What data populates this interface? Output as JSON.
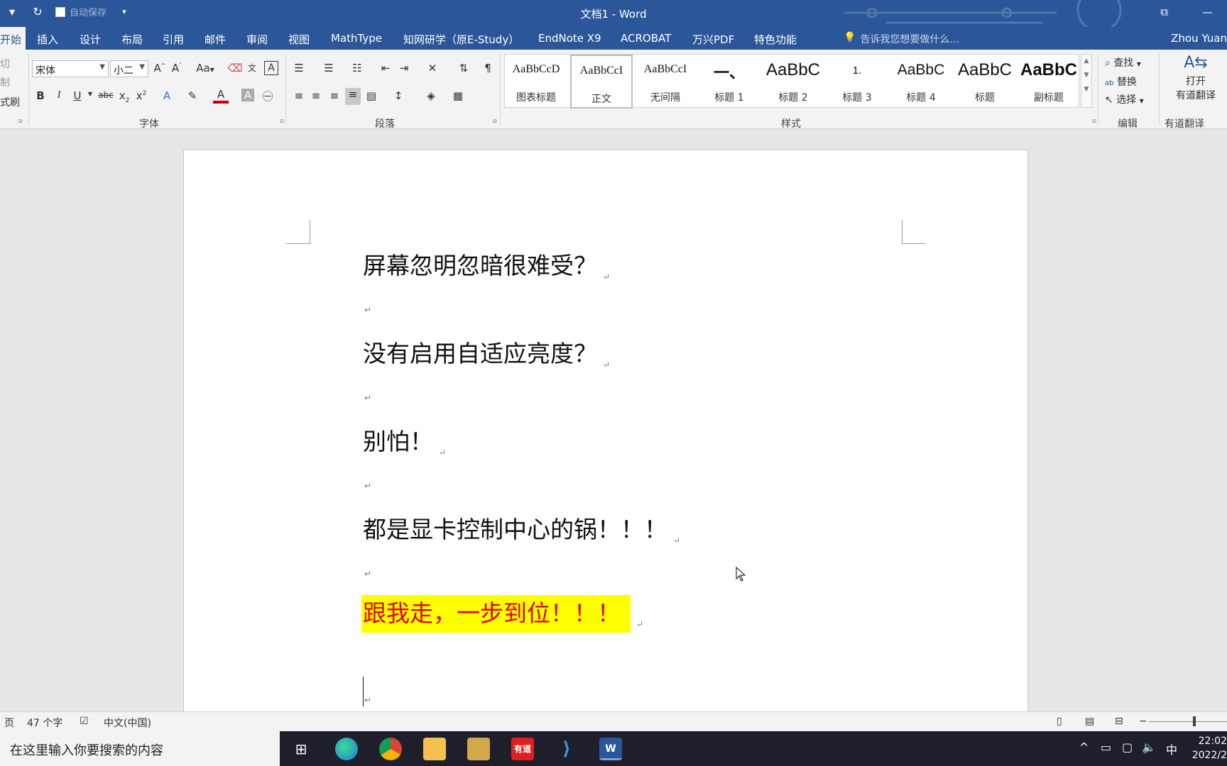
{
  "window": {
    "title": "文档1 - Word",
    "autosave_label": "自动保存",
    "user": "Zhou Yuan"
  },
  "tabs": [
    "开始",
    "插入",
    "设计",
    "布局",
    "引用",
    "邮件",
    "审阅",
    "视图",
    "MathType",
    "知网研学（原E-Study）",
    "EndNote X9",
    "ACROBAT",
    "万兴PDF",
    "特色功能"
  ],
  "tell_me": "告诉我您想要做什么...",
  "ribbon": {
    "clipboard": {
      "cut": "切",
      "copy": "制",
      "format_painter": "式刷"
    },
    "font": {
      "name": "宋体",
      "size": "小二",
      "change_case": "Aa",
      "group_label": "字体"
    },
    "paragraph": {
      "group_label": "段落"
    },
    "styles": {
      "group_label": "样式",
      "items": [
        {
          "sample": "AaBbCcD",
          "name": "图表标题"
        },
        {
          "sample": "AaBbCcI",
          "name": "正文"
        },
        {
          "sample": "AaBbCcI",
          "name": "无间隔"
        },
        {
          "sample": "一、",
          "name": "标题 1"
        },
        {
          "sample": "AaBbC",
          "name": "标题 2"
        },
        {
          "sample": "1.",
          "name": "标题 3"
        },
        {
          "sample": "AaBbC",
          "name": "标题 4"
        },
        {
          "sample": "AaBbC",
          "name": "标题"
        },
        {
          "sample": "AaBbC",
          "name": "副标题"
        }
      ]
    },
    "editing": {
      "find": "查找",
      "replace": "替换",
      "select": "选择",
      "group_label": "编辑"
    },
    "youdao": {
      "open": "打开",
      "translate": "有道翻译",
      "group_label": "有道翻译"
    }
  },
  "document": {
    "paragraphs": [
      "屏幕忽明忽暗很难受？",
      "没有启用自适应亮度？",
      "别怕！",
      "都是显卡控制中心的锅！！！",
      "跟我走，一步到位！！！"
    ],
    "paragraph_mark": "↵",
    "highlight_color": "#ffff00",
    "highlight_text_color": "#e00000"
  },
  "status": {
    "page": "页",
    "word_count": "47 个字",
    "language": "中文(中国)"
  },
  "taskbar": {
    "search_placeholder": "在这里输入你要搜索的内容",
    "youdao_label": "有道",
    "ime": "中",
    "time": "22:02",
    "date": "2022/2"
  }
}
